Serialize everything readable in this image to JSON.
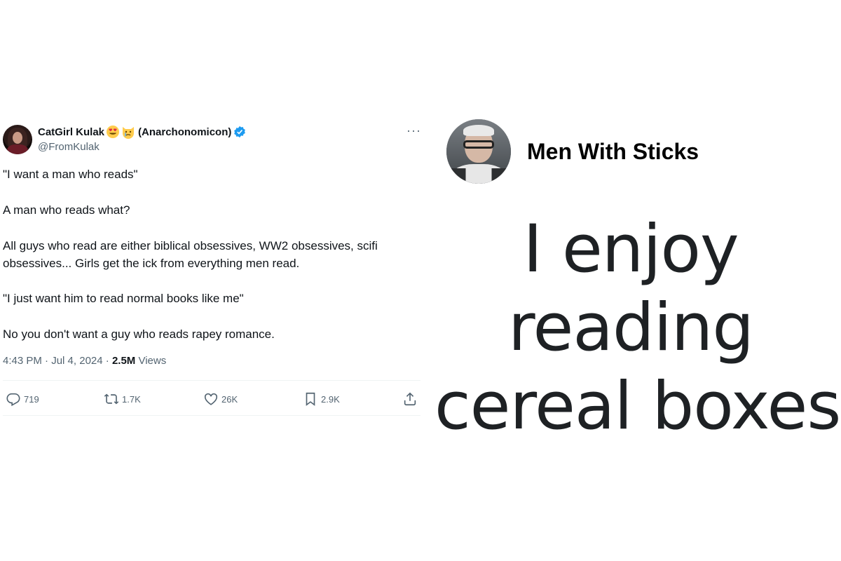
{
  "tweet": {
    "display_name": "CatGirl Kulak",
    "emojis": [
      "heart-eyes-emoji",
      "crying-cat-emoji"
    ],
    "paren_name": "(Anarchonomicon)",
    "verified": true,
    "handle": "@FromKulak",
    "more_label": "···",
    "paragraphs": [
      "\"I want a man who reads\"",
      "A man who reads what?",
      "All guys who read are either biblical obsessives, WW2 obsessives, scifi obsessives... Girls get the ick from everything men read.",
      "\"I just want him to read normal books like me\"",
      "No you don't want a guy who reads rapey romance."
    ],
    "time": "4:43 PM",
    "date": "Jul 4, 2024",
    "views_count": "2.5M",
    "views_label": "Views",
    "actions": {
      "replies": "719",
      "reposts": "1.7K",
      "likes": "26K",
      "bookmarks": "2.9K"
    },
    "accent_color": "#1d9bf0",
    "icons": [
      "reply-icon",
      "repost-icon",
      "like-icon",
      "bookmark-icon",
      "share-icon"
    ]
  },
  "meme": {
    "account_name": "Men With Sticks",
    "lines": [
      "I enjoy",
      "reading",
      "cereal boxes"
    ]
  }
}
